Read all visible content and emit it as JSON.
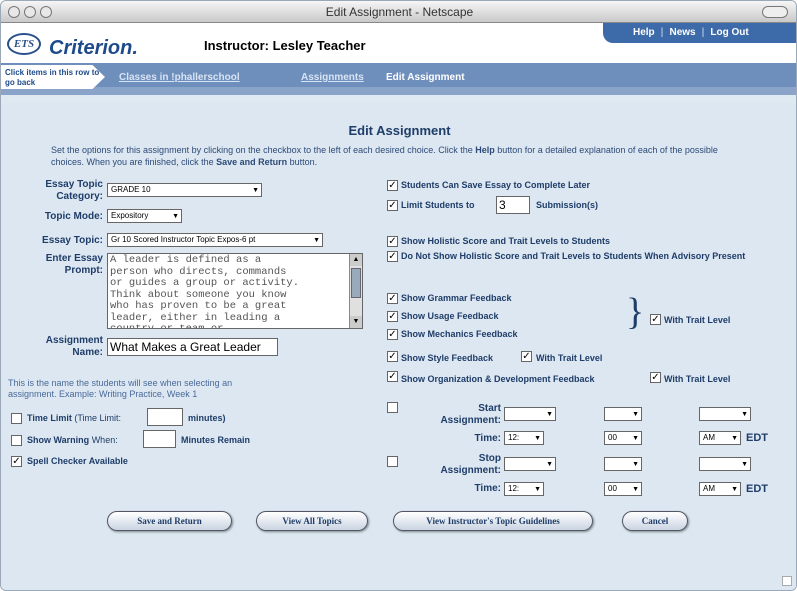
{
  "window": {
    "title": "Edit Assignment - Netscape"
  },
  "header": {
    "logo_mark": "ETS",
    "logo_text": "Criterion.",
    "instructor": "Instructor: Lesley Teacher",
    "nav": {
      "help": "Help",
      "news": "News",
      "logout": "Log Out",
      "sep": "|"
    }
  },
  "breadcrumb": {
    "hint": "Click items in this row to go back",
    "items": [
      "Classes in !phallerschool",
      "Assignments",
      "Edit Assignment"
    ]
  },
  "page": {
    "title": "Edit Assignment",
    "instructions_pre": "Set the options for this assignment by clicking on the checkbox to the left of each desired choice. Click the ",
    "instructions_help": "Help",
    "instructions_mid": " button for a detailed explanation of each of the possible choices. When you are finished, click the ",
    "instructions_save": "Save and Return",
    "instructions_post": " button."
  },
  "form": {
    "essay_topic_category_label": "Essay Topic Category:",
    "essay_topic_category_value": "GRADE 10",
    "topic_mode_label": "Topic Mode:",
    "topic_mode_value": "Expository",
    "essay_topic_label": "Essay Topic:",
    "essay_topic_value": "Gr 10 Scored Instructor Topic Expos-6 pt",
    "prompt_label": "Enter Essay Prompt:",
    "prompt_value": "A leader is defined as a\nperson who directs, commands\nor guides a group or activity.\nThink about someone you know\nwho has proven to be a great\nleader, either in leading a\ncountry or team or",
    "assignment_name_label": "Assignment Name:",
    "assignment_name_value": "What Makes a Great Leader",
    "assignment_name_note": "This is the name the students will see when selecting an assignment. Example: Writing Practice, Week 1",
    "time_limit_label": "Time Limit",
    "time_limit_paren": "(Time Limit:",
    "time_limit_units": "minutes)",
    "time_limit_checked": "",
    "show_warning_label": "Show Warning",
    "show_warning_when": "When:",
    "show_warning_units": "Minutes Remain",
    "show_warning_checked": "",
    "spell_checker_label": "Spell Checker Available",
    "spell_checker_checked": "✓"
  },
  "options": {
    "save_complete_later": {
      "label": "Students Can Save Essay to Complete Later",
      "mark": "✓"
    },
    "limit_students": {
      "label": "Limit Students to",
      "value": "3",
      "suffix": "Submission(s)",
      "mark": "✓"
    },
    "show_holistic": {
      "label": "Show Holistic Score and Trait Levels to Students",
      "mark": "✓"
    },
    "not_show_holistic": {
      "label": "Do Not Show Holistic Score and Trait Levels to Students When Advisory Present",
      "mark": "✓"
    },
    "grammar": {
      "label": "Show Grammar Feedback",
      "mark": "✓"
    },
    "usage": {
      "label": "Show Usage Feedback",
      "mark": "✓"
    },
    "mechanics": {
      "label": "Show Mechanics Feedback",
      "mark": "✓"
    },
    "gum_trait": {
      "label": "With Trait Level",
      "mark": "✓"
    },
    "style": {
      "label": "Show Style Feedback",
      "mark": "✓"
    },
    "style_trait": {
      "label": "With Trait Level",
      "mark": "✓"
    },
    "org_dev": {
      "label": "Show Organization & Development Feedback",
      "mark": "✓"
    },
    "org_trait": {
      "label": "With Trait Level",
      "mark": "✓"
    }
  },
  "schedule": {
    "start_label": "Start Assignment:",
    "stop_label": "Stop Assignment:",
    "time_label": "Time:",
    "start_checked": "",
    "stop_checked": "",
    "hour": "12:",
    "minute": "00",
    "ampm": "AM",
    "tz": "EDT",
    "arrow": "▼"
  },
  "buttons": {
    "save": "Save and Return",
    "view_all": "View All Topics",
    "guidelines": "View Instructor's Topic Guidelines",
    "cancel": "Cancel"
  },
  "colors": {
    "accent": "#3d6aa8",
    "breadcrumb": "#6e8ebc",
    "content_bg": "#dce7f1",
    "label": "#1f3d69"
  }
}
